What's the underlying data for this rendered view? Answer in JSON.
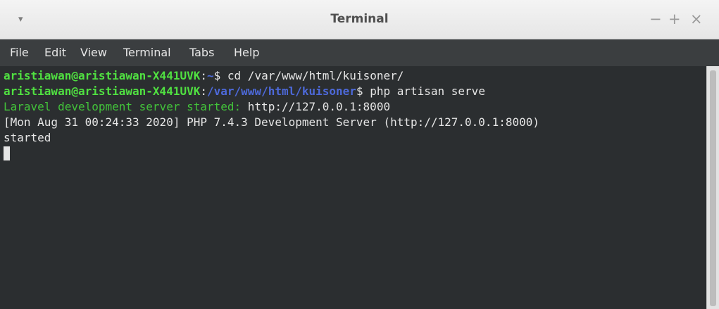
{
  "window": {
    "title": "Terminal",
    "menu_arrow": "▾",
    "minimize": "−",
    "maximize": "+",
    "close": "×"
  },
  "menu": [
    "File",
    "Edit",
    "View",
    "Terminal",
    "Tabs",
    "Help"
  ],
  "terminal": {
    "line1": {
      "user": "aristiawan@aristiawan-X441UVK",
      "sep": ":",
      "path": "~",
      "prompt_cmd": "$ cd /var/www/html/kuisoner/"
    },
    "line2": {
      "user": "aristiawan@aristiawan-X441UVK",
      "sep": ":",
      "path": "/var/www/html/kuisoner",
      "prompt_cmd": "$ php artisan serve"
    },
    "line3": {
      "label": "Laravel development server started:",
      "url": " http://127.0.0.1:8000"
    },
    "line4": "[Mon Aug 31 00:24:33 2020] PHP 7.4.3 Development Server (http://127.0.0.1:8000)",
    "line5": "started"
  },
  "colors": {
    "prompt_user": "#50e041",
    "prompt_path": "#4d69d9",
    "info_text": "#42c23a",
    "foreground": "#e6e6e6",
    "background": "#2b2e30"
  }
}
